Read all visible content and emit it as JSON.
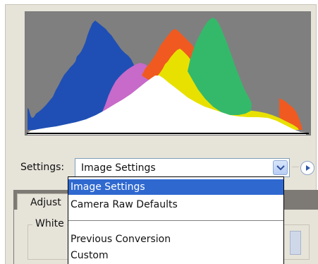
{
  "histogram": {
    "label": "histogram",
    "colors": {
      "background": "#7f7f7f",
      "blue": "#1f4fb5",
      "magenta": "#c76ac9",
      "red": "#f05a20",
      "yellow": "#e8e100",
      "green": "#34b96a",
      "white": "#ffffff"
    }
  },
  "settings": {
    "label": "Settings:",
    "value": "Image Settings",
    "menu_icon": "flyout-menu-icon",
    "dropdown_icon": "chevron-down-icon",
    "options": [
      "Image Settings",
      "Camera Raw Defaults",
      "Previous Conversion",
      "Custom"
    ]
  },
  "tabs": {
    "adjust": "Adjust"
  },
  "adjust_panel": {
    "group_label": "White"
  },
  "colors": {
    "panel_bg": "#e6e3d9",
    "selection": "#2f69d0"
  }
}
